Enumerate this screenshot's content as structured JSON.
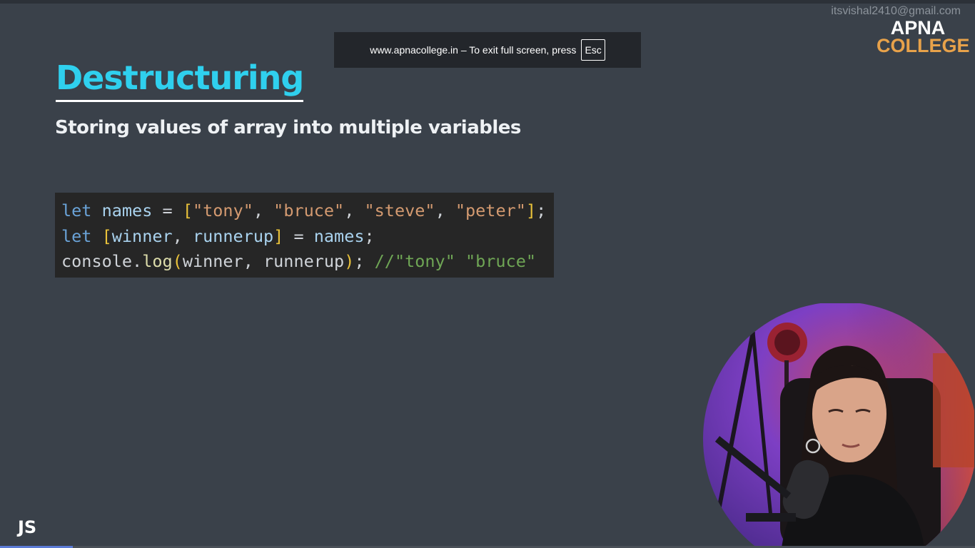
{
  "overlay": {
    "email": "itsvishal2410@gmail.com",
    "logo_line1": "APNA",
    "logo_line2": "COLLEGE"
  },
  "fullscreen_notice": {
    "message": "www.apnacollege.in – To exit full screen, press",
    "key": "Esc"
  },
  "slide": {
    "title": "Destructuring",
    "subtitle": "Storing values of array into multiple variables",
    "code": {
      "line1": {
        "kw": "let",
        "var": "names",
        "eq": "=",
        "open": "[",
        "s1": "\"tony\"",
        "s2": "\"bruce\"",
        "s3": "\"steve\"",
        "s4": "\"peter\"",
        "close": "]",
        "semi": ";"
      },
      "line2": {
        "kw": "let",
        "open": "[",
        "v1": "winner",
        "v2": "runnerup",
        "close": "]",
        "eq": "=",
        "src": "names",
        "semi": ";"
      },
      "line3": {
        "obj": "console",
        "dot": ".",
        "fn": "log",
        "open": "(",
        "args": "winner, runnerup",
        "close": ")",
        "semi": ";",
        "comment": "//\"tony\" \"bruce\""
      }
    },
    "badge": "JS"
  },
  "player": {
    "progress": 0.075
  },
  "colors": {
    "background": "#3a414a",
    "title": "#2fd0ee",
    "code_bg": "#262626",
    "keyword": "#6aa3d8",
    "string": "#d49a70",
    "bracket": "#e9c23a",
    "comment": "#6fa655",
    "logo_accent": "#e8a24a"
  }
}
